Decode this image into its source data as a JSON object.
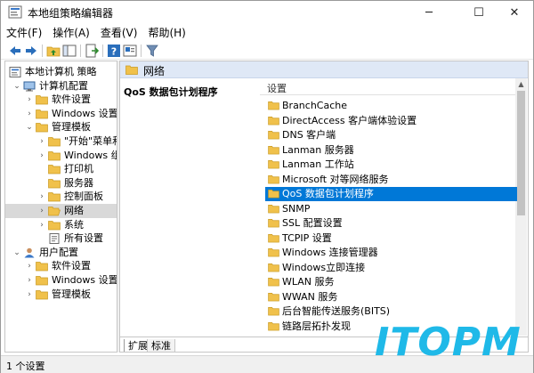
{
  "window": {
    "title": "本地组策略编辑器",
    "controls": {
      "minimize": "─",
      "maximize": "☐",
      "close": "✕"
    }
  },
  "menu": [
    "文件(F)",
    "操作(A)",
    "查看(V)",
    "帮助(H)"
  ],
  "toolbar": [
    "back-arrow-icon",
    "forward-arrow-icon",
    "up-folder-icon",
    "show-tree-icon",
    "export-list-icon",
    "help-icon",
    "properties-icon",
    "filter-icon"
  ],
  "tree": [
    {
      "label": "本地计算机 策略",
      "level": 0,
      "arrow": "",
      "icon": "policy-icon"
    },
    {
      "label": "计算机配置",
      "level": 1,
      "arrow": "⌄",
      "icon": "computer-icon"
    },
    {
      "label": "软件设置",
      "level": 2,
      "arrow": "›",
      "icon": "folder-icon"
    },
    {
      "label": "Windows 设置",
      "level": 2,
      "arrow": "›",
      "icon": "folder-icon"
    },
    {
      "label": "管理模板",
      "level": 2,
      "arrow": "⌄",
      "icon": "folder-icon"
    },
    {
      "label": "\"开始\"菜单和",
      "level": 3,
      "arrow": "›",
      "icon": "folder-icon"
    },
    {
      "label": "Windows 组",
      "level": 3,
      "arrow": "›",
      "icon": "folder-icon"
    },
    {
      "label": "打印机",
      "level": 3,
      "arrow": "",
      "icon": "folder-icon"
    },
    {
      "label": "服务器",
      "level": 3,
      "arrow": "",
      "icon": "folder-icon"
    },
    {
      "label": "控制面板",
      "level": 3,
      "arrow": "›",
      "icon": "folder-icon"
    },
    {
      "label": "网络",
      "level": 3,
      "arrow": "›",
      "icon": "folder-open-icon",
      "selected": true
    },
    {
      "label": "系统",
      "level": 3,
      "arrow": "›",
      "icon": "folder-icon"
    },
    {
      "label": "所有设置",
      "level": 3,
      "arrow": "",
      "icon": "settings-page-icon"
    },
    {
      "label": "用户配置",
      "level": 1,
      "arrow": "⌄",
      "icon": "user-icon"
    },
    {
      "label": "软件设置",
      "level": 2,
      "arrow": "›",
      "icon": "folder-icon"
    },
    {
      "label": "Windows 设置",
      "level": 2,
      "arrow": "›",
      "icon": "folder-icon"
    },
    {
      "label": "管理模板",
      "level": 2,
      "arrow": "›",
      "icon": "folder-icon"
    }
  ],
  "right": {
    "header": "网络",
    "description_title": "QoS 数据包计划程序",
    "column_header": "设置",
    "items": [
      {
        "label": "BranchCache"
      },
      {
        "label": "DirectAccess 客户端体验设置"
      },
      {
        "label": "DNS 客户端"
      },
      {
        "label": "Lanman 服务器"
      },
      {
        "label": "Lanman 工作站"
      },
      {
        "label": "Microsoft 对等网络服务"
      },
      {
        "label": "QoS 数据包计划程序",
        "selected": true
      },
      {
        "label": "SNMP"
      },
      {
        "label": "SSL 配置设置"
      },
      {
        "label": "TCPIP 设置"
      },
      {
        "label": "Windows 连接管理器"
      },
      {
        "label": "Windows立即连接"
      },
      {
        "label": "WLAN 服务"
      },
      {
        "label": "WWAN 服务"
      },
      {
        "label": "后台智能传送服务(BITS)"
      },
      {
        "label": "链路层拓扑发现"
      }
    ],
    "tabs": [
      "扩展",
      "标准"
    ]
  },
  "status": "1 个设置",
  "watermark": {
    "text": "ITOPM",
    "color": "#1fb9e8"
  },
  "colors": {
    "selection": "#0078d7",
    "header": "#dfe8f6",
    "folder": "#f0c14b"
  }
}
